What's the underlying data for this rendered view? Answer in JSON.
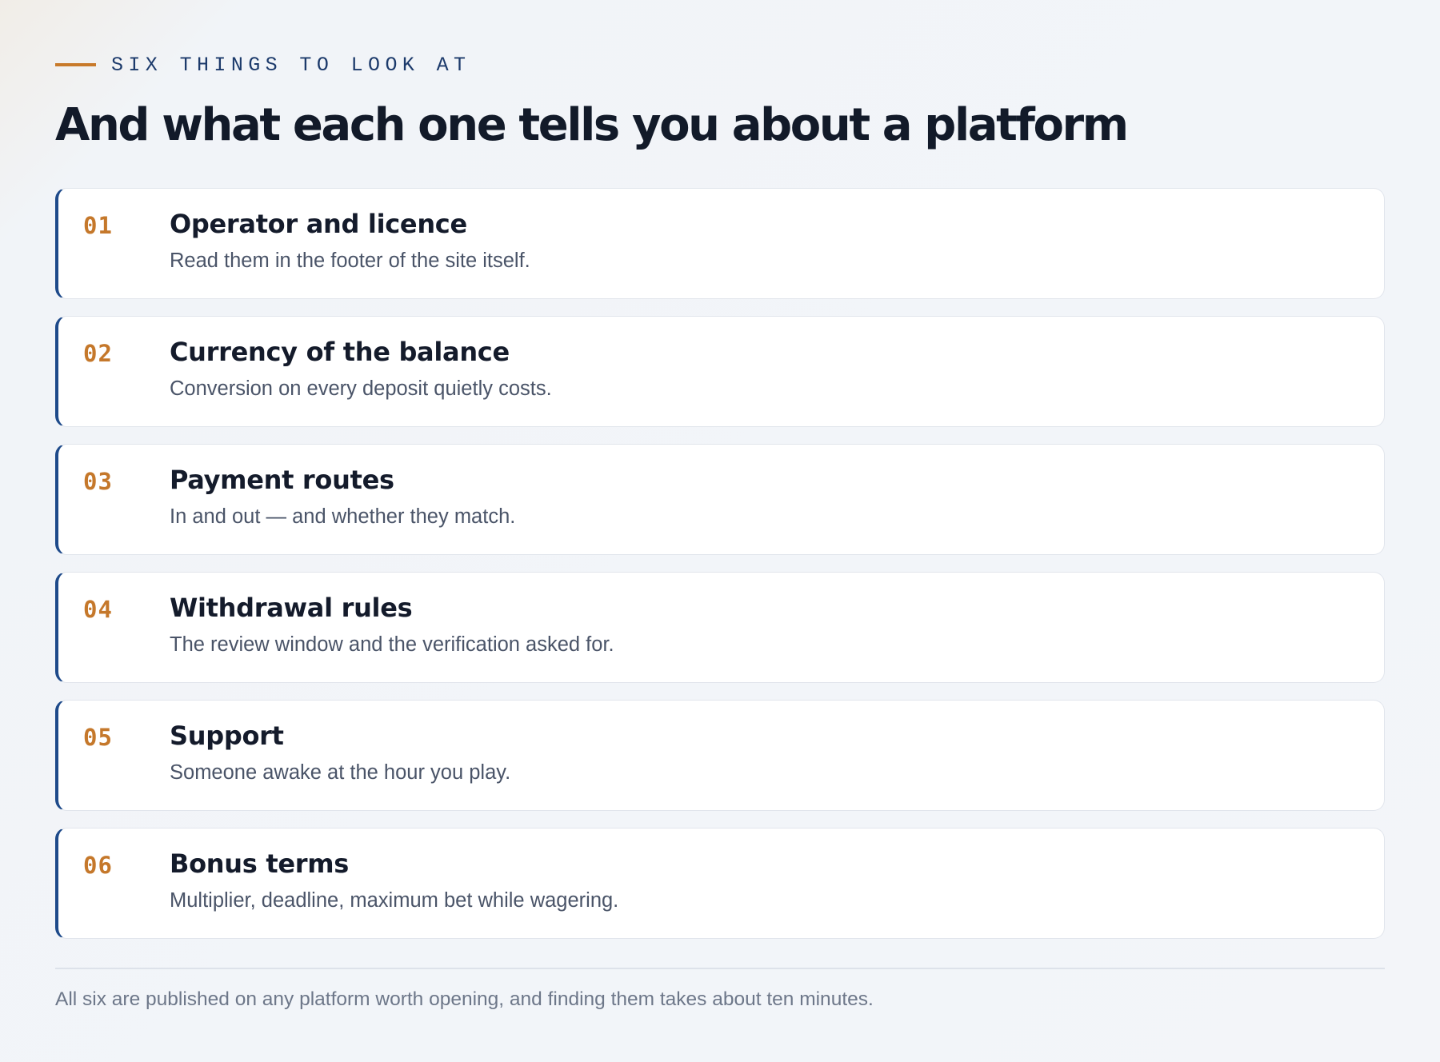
{
  "eyebrow": {
    "text": "SIX THINGS TO LOOK AT"
  },
  "headline": "And what each one tells you about a platform",
  "items": [
    {
      "number": "01",
      "title": "Operator and licence",
      "description": "Read them in the footer of the site itself."
    },
    {
      "number": "02",
      "title": "Currency of the balance",
      "description": "Conversion on every deposit quietly costs."
    },
    {
      "number": "03",
      "title": "Payment routes",
      "description": "In and out — and whether they match."
    },
    {
      "number": "04",
      "title": "Withdrawal rules",
      "description": "The review window and the verification asked for."
    },
    {
      "number": "05",
      "title": "Support",
      "description": "Someone awake at the hour you play."
    },
    {
      "number": "06",
      "title": "Bonus terms",
      "description": "Multiplier, deadline, maximum bet while wagering."
    }
  ],
  "footnote": "All six are published on any platform worth opening, and finding them takes about ten minutes.",
  "colors": {
    "accent": "#c87a2a",
    "navy": "#1e4a8a",
    "heading": "#121a29",
    "muted": "#6d7789"
  }
}
